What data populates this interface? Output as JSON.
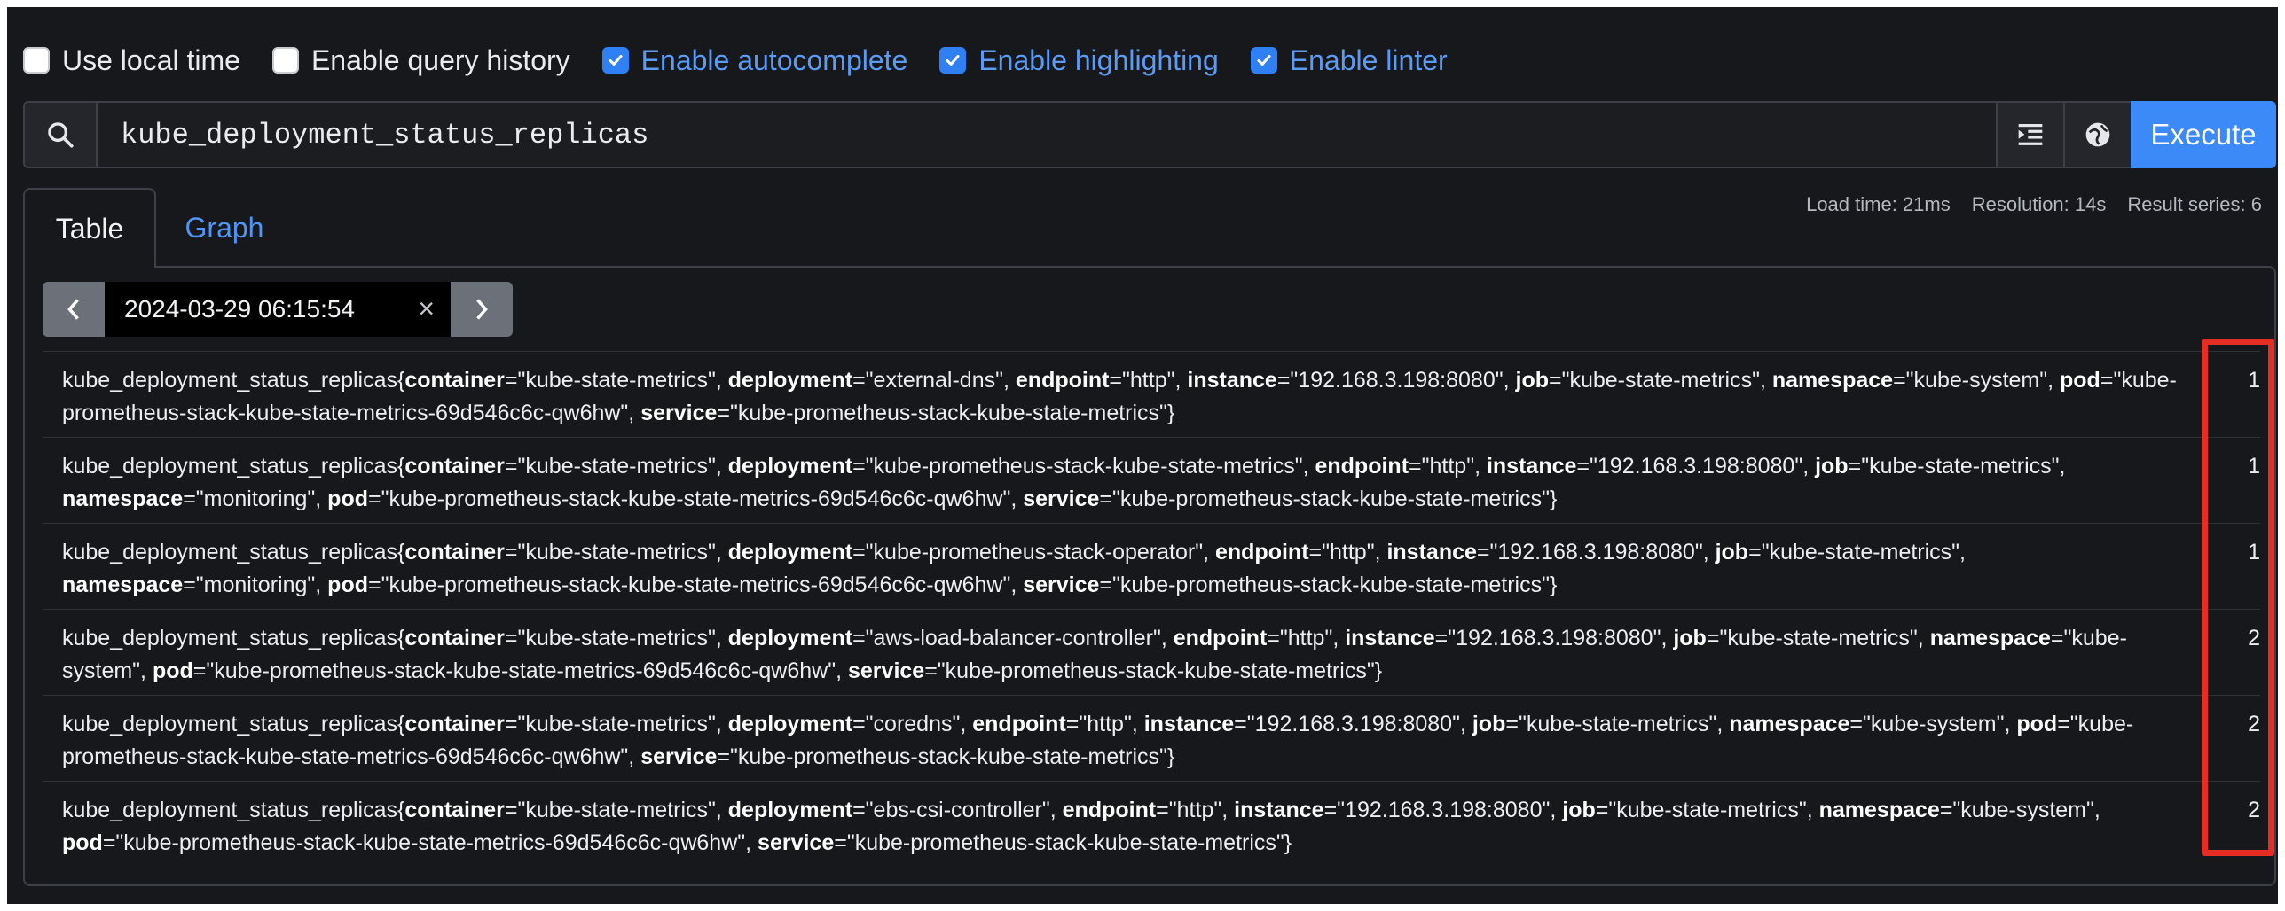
{
  "options": [
    {
      "label": "Use local time",
      "checked": false
    },
    {
      "label": "Enable query history",
      "checked": false
    },
    {
      "label": "Enable autocomplete",
      "checked": true
    },
    {
      "label": "Enable highlighting",
      "checked": true
    },
    {
      "label": "Enable linter",
      "checked": true
    }
  ],
  "query": {
    "expression": "kube_deployment_status_replicas",
    "execute_label": "Execute"
  },
  "icons": {
    "search": "search-icon",
    "format": "format-query-icon",
    "metrics": "metrics-explorer-icon",
    "clear": "clear-icon",
    "prev": "chevron-left-icon",
    "next": "chevron-right-icon"
  },
  "tabs": {
    "table": "Table",
    "graph": "Graph",
    "active": "Table"
  },
  "stats": {
    "load_time": "Load time: 21ms",
    "resolution": "Resolution: 14s",
    "result_series": "Result series: 6"
  },
  "eval_time": "2024-03-29 06:15:54",
  "colors": {
    "accent": "#3b8af7",
    "highlight": "#e42d23",
    "background": "#17181b"
  },
  "results": [
    {
      "metric": "kube_deployment_status_replicas",
      "labels": [
        [
          "container",
          "kube-state-metrics"
        ],
        [
          "deployment",
          "external-dns"
        ],
        [
          "endpoint",
          "http"
        ],
        [
          "instance",
          "192.168.3.198:8080"
        ],
        [
          "job",
          "kube-state-metrics"
        ],
        [
          "namespace",
          "kube-system"
        ],
        [
          "pod",
          "kube-prometheus-stack-kube-state-metrics-69d546c6c-qw6hw"
        ],
        [
          "service",
          "kube-prometheus-stack-kube-state-metrics"
        ]
      ],
      "value": "1"
    },
    {
      "metric": "kube_deployment_status_replicas",
      "labels": [
        [
          "container",
          "kube-state-metrics"
        ],
        [
          "deployment",
          "kube-prometheus-stack-kube-state-metrics"
        ],
        [
          "endpoint",
          "http"
        ],
        [
          "instance",
          "192.168.3.198:8080"
        ],
        [
          "job",
          "kube-state-metrics"
        ],
        [
          "namespace",
          "monitoring"
        ],
        [
          "pod",
          "kube-prometheus-stack-kube-state-metrics-69d546c6c-qw6hw"
        ],
        [
          "service",
          "kube-prometheus-stack-kube-state-metrics"
        ]
      ],
      "value": "1"
    },
    {
      "metric": "kube_deployment_status_replicas",
      "labels": [
        [
          "container",
          "kube-state-metrics"
        ],
        [
          "deployment",
          "kube-prometheus-stack-operator"
        ],
        [
          "endpoint",
          "http"
        ],
        [
          "instance",
          "192.168.3.198:8080"
        ],
        [
          "job",
          "kube-state-metrics"
        ],
        [
          "namespace",
          "monitoring"
        ],
        [
          "pod",
          "kube-prometheus-stack-kube-state-metrics-69d546c6c-qw6hw"
        ],
        [
          "service",
          "kube-prometheus-stack-kube-state-metrics"
        ]
      ],
      "value": "1"
    },
    {
      "metric": "kube_deployment_status_replicas",
      "labels": [
        [
          "container",
          "kube-state-metrics"
        ],
        [
          "deployment",
          "aws-load-balancer-controller"
        ],
        [
          "endpoint",
          "http"
        ],
        [
          "instance",
          "192.168.3.198:8080"
        ],
        [
          "job",
          "kube-state-metrics"
        ],
        [
          "namespace",
          "kube-system"
        ],
        [
          "pod",
          "kube-prometheus-stack-kube-state-metrics-69d546c6c-qw6hw"
        ],
        [
          "service",
          "kube-prometheus-stack-kube-state-metrics"
        ]
      ],
      "value": "2"
    },
    {
      "metric": "kube_deployment_status_replicas",
      "labels": [
        [
          "container",
          "kube-state-metrics"
        ],
        [
          "deployment",
          "coredns"
        ],
        [
          "endpoint",
          "http"
        ],
        [
          "instance",
          "192.168.3.198:8080"
        ],
        [
          "job",
          "kube-state-metrics"
        ],
        [
          "namespace",
          "kube-system"
        ],
        [
          "pod",
          "kube-prometheus-stack-kube-state-metrics-69d546c6c-qw6hw"
        ],
        [
          "service",
          "kube-prometheus-stack-kube-state-metrics"
        ]
      ],
      "value": "2"
    },
    {
      "metric": "kube_deployment_status_replicas",
      "labels": [
        [
          "container",
          "kube-state-metrics"
        ],
        [
          "deployment",
          "ebs-csi-controller"
        ],
        [
          "endpoint",
          "http"
        ],
        [
          "instance",
          "192.168.3.198:8080"
        ],
        [
          "job",
          "kube-state-metrics"
        ],
        [
          "namespace",
          "kube-system"
        ],
        [
          "pod",
          "kube-prometheus-stack-kube-state-metrics-69d546c6c-qw6hw"
        ],
        [
          "service",
          "kube-prometheus-stack-kube-state-metrics"
        ]
      ],
      "value": "2"
    }
  ]
}
